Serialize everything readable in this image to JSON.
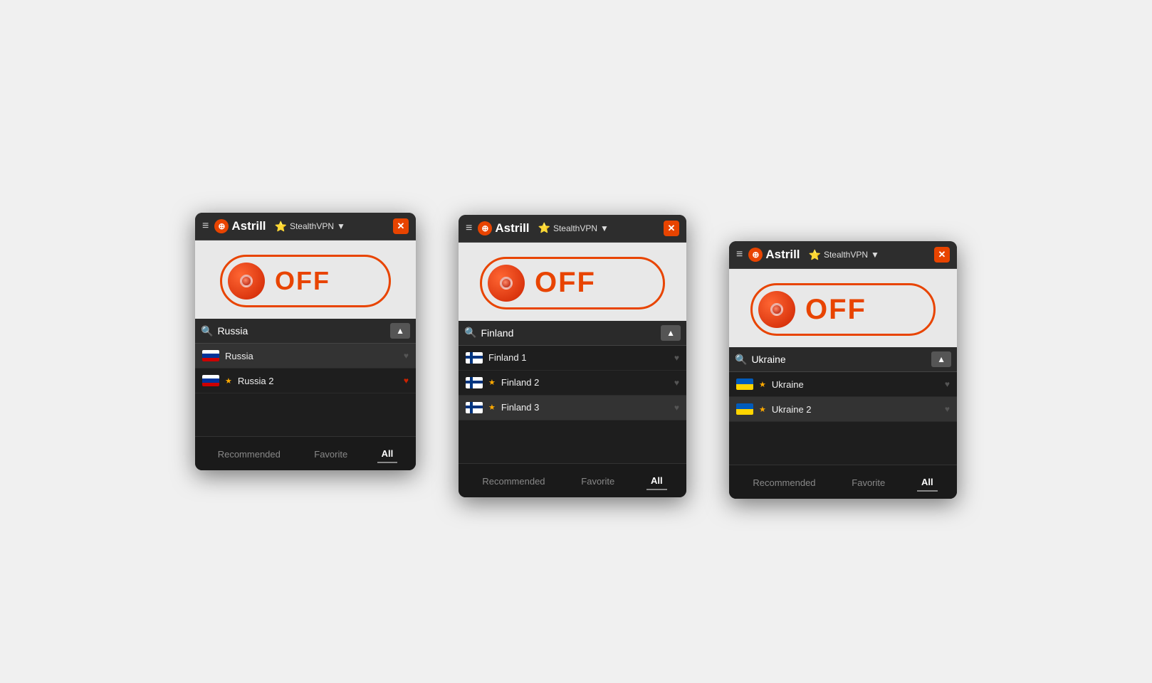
{
  "windows": [
    {
      "id": "window-1",
      "title": "Astrill",
      "protocol": "StealthVPN",
      "toggle_state": "OFF",
      "search_value": "Russia",
      "search_placeholder": "Russia",
      "servers": [
        {
          "name": "Russia",
          "flag": "russia",
          "starred": false,
          "selected": true,
          "favorited": false
        },
        {
          "name": "Russia 2",
          "flag": "russia",
          "starred": true,
          "selected": false,
          "favorited": true
        }
      ],
      "tabs": [
        {
          "label": "Recommended",
          "active": false
        },
        {
          "label": "Favorite",
          "active": false
        },
        {
          "label": "All",
          "active": true
        }
      ]
    },
    {
      "id": "window-2",
      "title": "Astrill",
      "protocol": "StealthVPN",
      "toggle_state": "OFF",
      "search_value": "Finland",
      "search_placeholder": "Finland",
      "servers": [
        {
          "name": "Finland 1",
          "flag": "finland",
          "starred": false,
          "selected": false,
          "favorited": false
        },
        {
          "name": "Finland 2",
          "flag": "finland",
          "starred": true,
          "selected": false,
          "favorited": false
        },
        {
          "name": "Finland 3",
          "flag": "finland",
          "starred": true,
          "selected": true,
          "favorited": false
        }
      ],
      "tabs": [
        {
          "label": "Recommended",
          "active": false
        },
        {
          "label": "Favorite",
          "active": false
        },
        {
          "label": "All",
          "active": true
        }
      ]
    },
    {
      "id": "window-3",
      "title": "Astrill",
      "protocol": "StealthVPN",
      "toggle_state": "OFF",
      "search_value": "Ukraine",
      "search_placeholder": "Ukraine",
      "servers": [
        {
          "name": "Ukraine",
          "flag": "ukraine",
          "starred": true,
          "selected": false,
          "favorited": false
        },
        {
          "name": "Ukraine 2",
          "flag": "ukraine",
          "starred": true,
          "selected": true,
          "favorited": false
        }
      ],
      "tabs": [
        {
          "label": "Recommended",
          "active": false
        },
        {
          "label": "Favorite",
          "active": false
        },
        {
          "label": "All",
          "active": true
        }
      ]
    }
  ],
  "icons": {
    "menu": "≡",
    "globe": "🌐",
    "star": "★",
    "close": "✕",
    "search": "🔍",
    "heart": "♥",
    "sort": "▲",
    "chevron": "▼"
  }
}
